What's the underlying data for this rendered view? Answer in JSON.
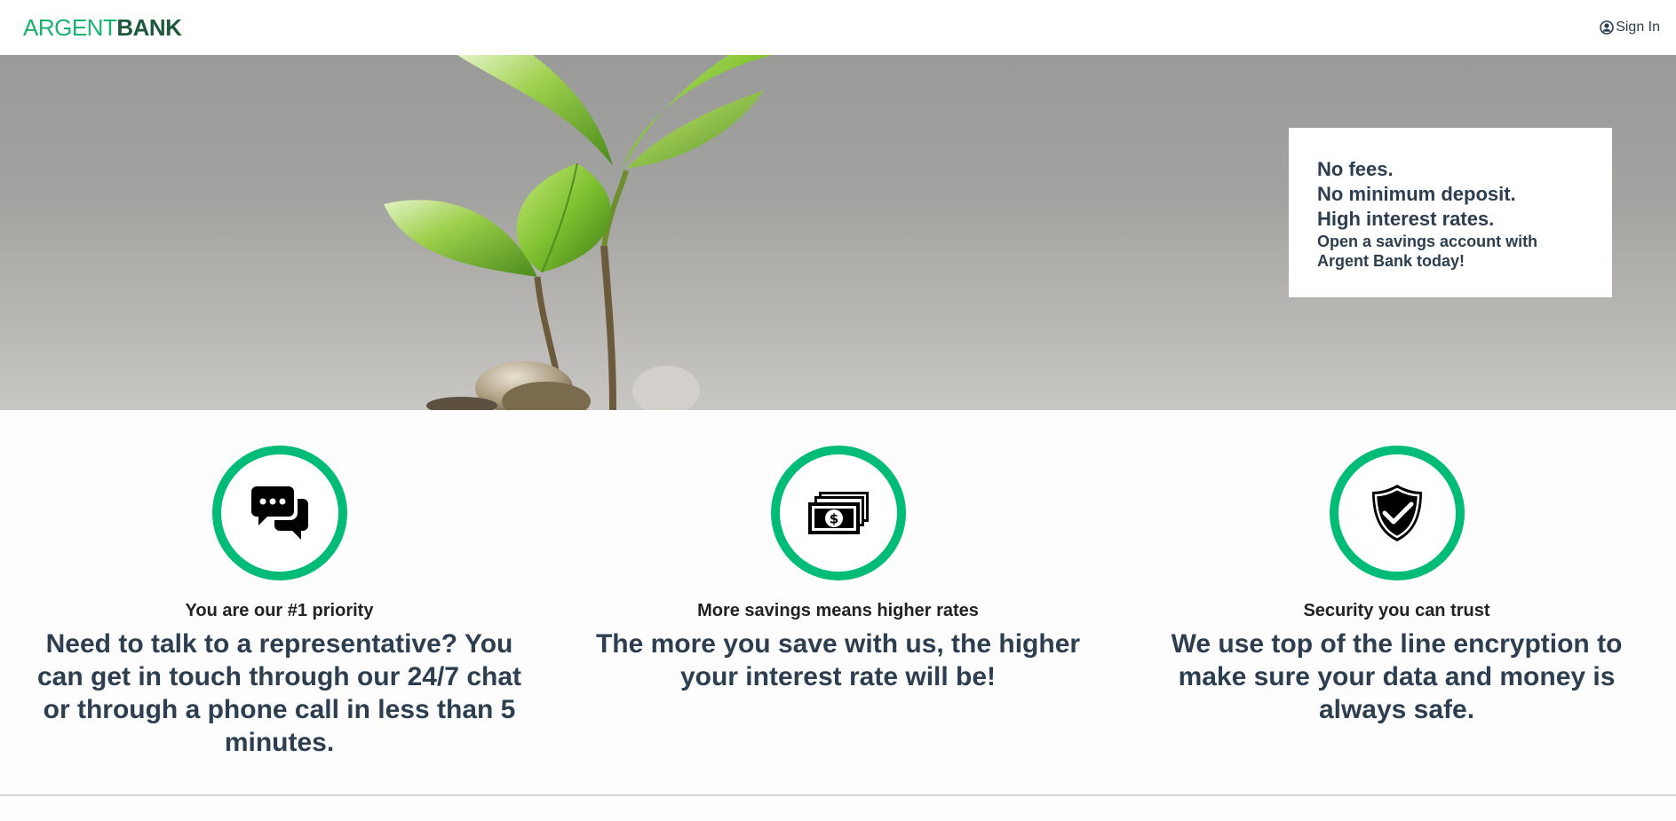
{
  "header": {
    "logo_part1": "ARGENT",
    "logo_part2": "BANK",
    "signin_label": "Sign In",
    "signin_icon": "user-circle-icon"
  },
  "hero": {
    "lines": [
      "No fees.",
      "No minimum deposit.",
      "High interest rates."
    ],
    "subtitle": "Open a savings account with Argent Bank today!"
  },
  "features": [
    {
      "icon": "chat-icon",
      "title": "You are our #1 priority",
      "text": "Need to talk to a representative? You can get in touch through our 24/7 chat or through a phone call in less than 5 minutes."
    },
    {
      "icon": "money-icon",
      "title": "More savings means higher rates",
      "text": "The more you save with us, the higher your interest rate will be!"
    },
    {
      "icon": "security-icon",
      "title": "Security you can trust",
      "text": "We use top of the line encryption to make sure your data and money is always safe."
    }
  ],
  "colors": {
    "accent": "#00bc77",
    "text": "#2c3e50",
    "logo_dark": "#1d5a3c"
  }
}
